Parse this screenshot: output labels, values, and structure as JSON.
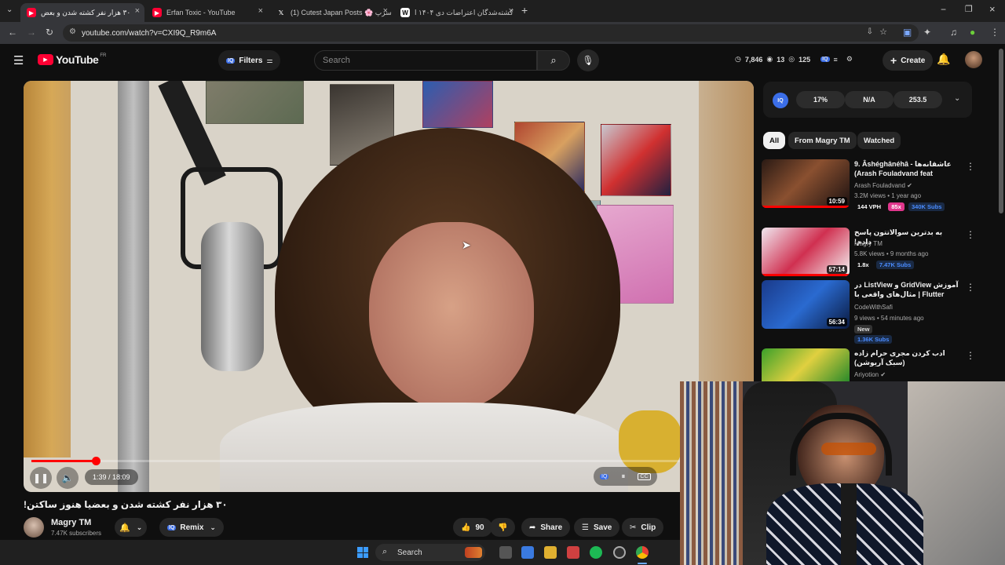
{
  "browser": {
    "tabs": [
      {
        "title": "۳۰ هزار نفر کشته شدن و بعض",
        "active": true,
        "favicon_color": "#ff0033"
      },
      {
        "title": "Erfan Toxic - YouTube",
        "active": false,
        "favicon_color": "#ff0033"
      },
      {
        "title": "(1) Cutest Japan Posts 🌸 سرپ",
        "active": false,
        "favicon_color": "#ffffff"
      },
      {
        "title": "کشته‌شدگان اعتراضات دی ۱۴۰۴ ا",
        "active": false,
        "favicon_color": "#ffffff"
      }
    ],
    "url": "youtube.com/watch?v=CXI9Q_R9m6A"
  },
  "header": {
    "logo_text": "YouTube",
    "logo_region": "FR",
    "filters_label": "Filters",
    "search_placeholder": "Search",
    "stats": {
      "views": "7,846",
      "eye": "13",
      "count": "125"
    },
    "create_label": "Create"
  },
  "video": {
    "time_current": "1:39",
    "time_total": "18:09",
    "time_display": "1:39 / 18:09",
    "progress": 0.09,
    "title": "۳۰ هزار نفر کشته شدن و بعضیا هنوز ساکتن!"
  },
  "channel": {
    "name": "Magry TM",
    "subscribers": "7.47K subscribers",
    "remix_label": "Remix",
    "likes": "90",
    "share_label": "Share",
    "save_label": "Save",
    "clip_label": "Clip"
  },
  "iq_panel": {
    "metric1": "17%",
    "metric2": "N/A",
    "metric3": "253.5"
  },
  "filter_chips": [
    "All",
    "From Magry TM",
    "Watched"
  ],
  "recommendations": [
    {
      "title": "9. Âshéghânéhâ - عاشقانه‌ها (Arash Fouladvand feat Nigina...",
      "channel": "Arash Fouladvand",
      "meta": "3.2M views • 1 year ago",
      "duration": "10:59",
      "badges": [
        "144 VPH",
        "85x",
        "340K Subs"
      ]
    },
    {
      "title": "به بدترین سوالاتتون پاسخ دادم!",
      "channel": "Magry TM",
      "meta": "5.8K views • 9 months ago",
      "duration": "57:14",
      "badges": [
        "1.8x",
        "7.47K Subs"
      ]
    },
    {
      "title": "آموزش GridView و ListView در Flutter | مثال‌های واقعی با builder ...",
      "channel": "CodeWithSafi",
      "meta": "9 views • 54 minutes ago",
      "duration": "56:34",
      "badges": [
        "New",
        "1.36K Subs"
      ]
    },
    {
      "title": "ادب کردن مجری حرام زاده (سبک آریوشن)",
      "channel": "Ariyotion",
      "meta": "",
      "duration": "",
      "badges": []
    }
  ],
  "taskbar": {
    "search_label": "Search"
  }
}
